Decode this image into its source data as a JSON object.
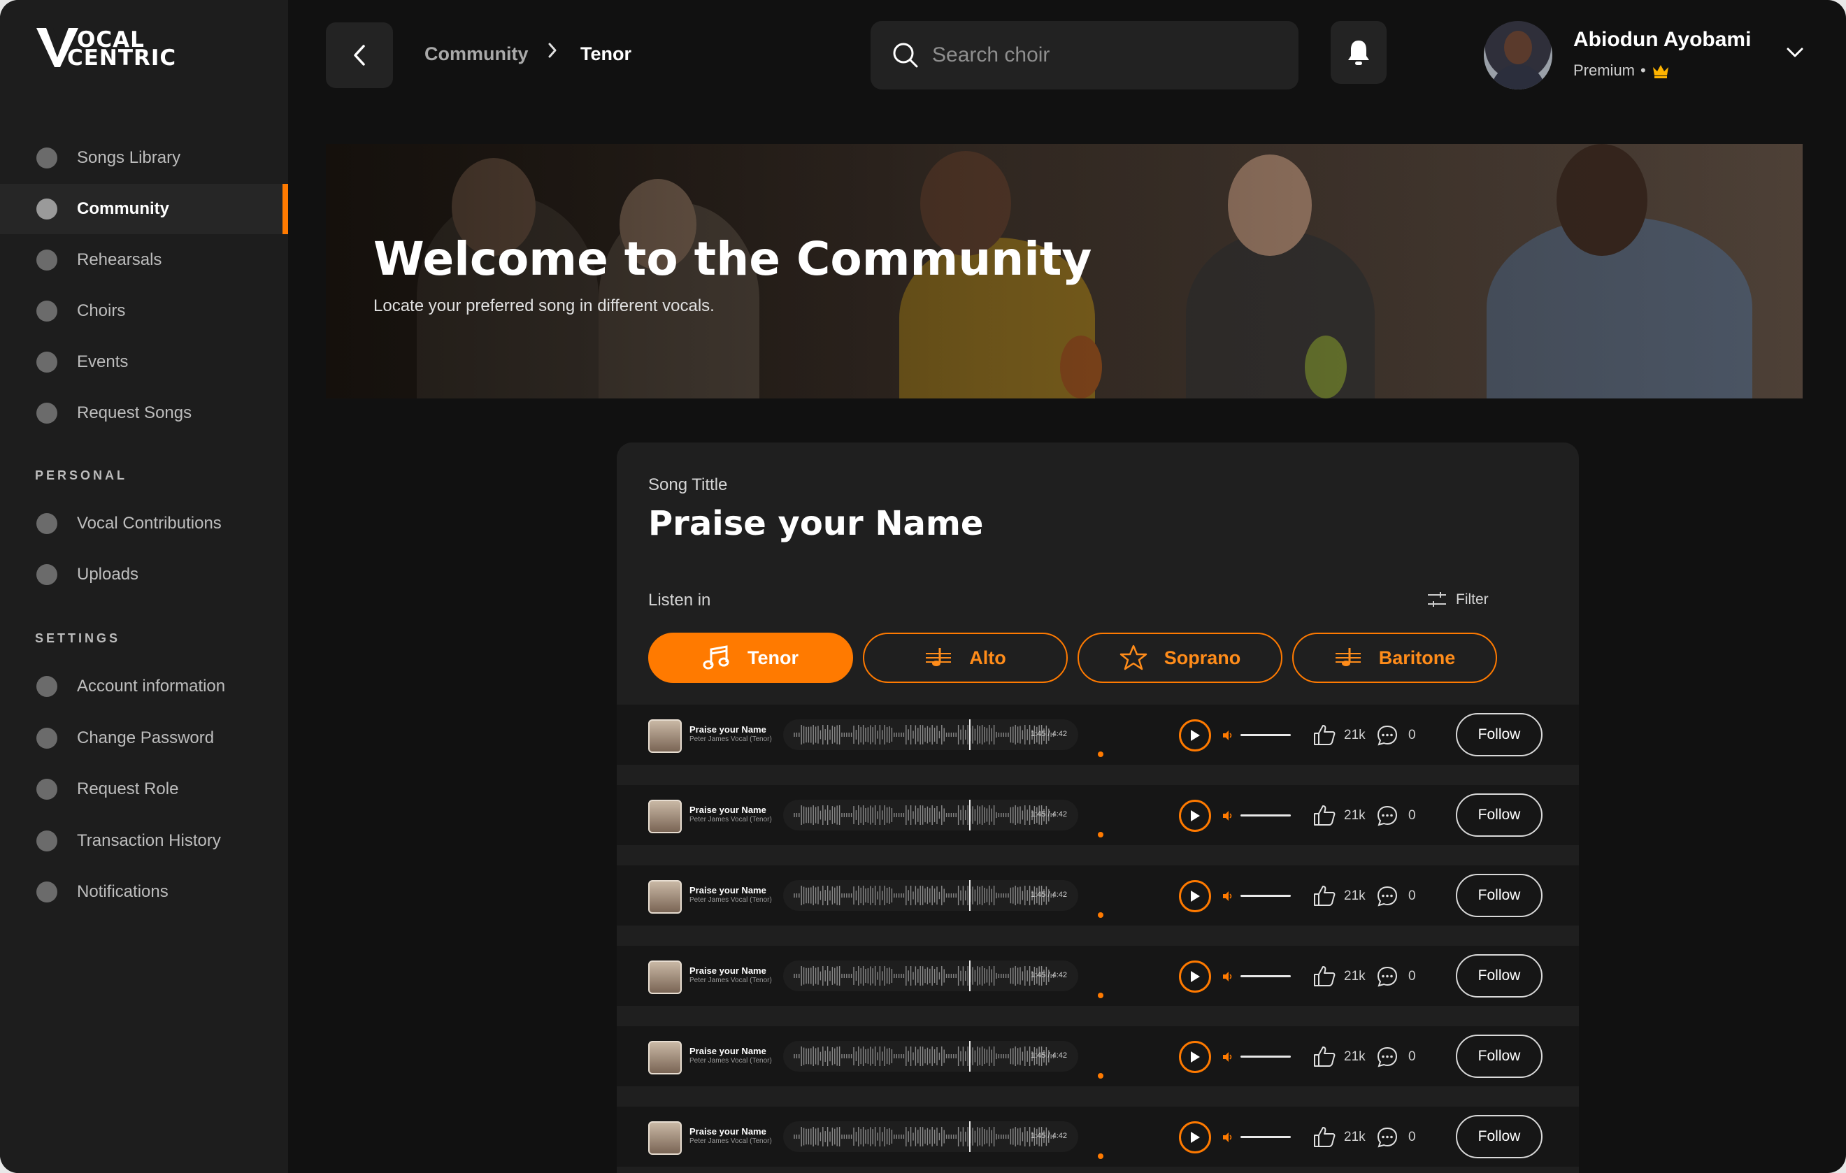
{
  "app": {
    "logo_top": "OCAL",
    "logo_bottom": "CENTRIC"
  },
  "sidebar": {
    "main_items": [
      {
        "label": "Songs Library",
        "icon": "library-icon"
      },
      {
        "label": "Community",
        "icon": "community-icon",
        "active": true
      },
      {
        "label": "Rehearsals",
        "icon": "rehearsal-icon"
      },
      {
        "label": "Choirs",
        "icon": "choir-icon"
      },
      {
        "label": "Events",
        "icon": "events-icon"
      },
      {
        "label": "Request Songs",
        "icon": "request-icon"
      }
    ],
    "personal_label": "PERSONAL",
    "personal_items": [
      {
        "label": "Vocal Contributions",
        "icon": "vocal-icon"
      },
      {
        "label": "Uploads",
        "icon": "upload-icon"
      }
    ],
    "settings_label": "SETTINGS",
    "settings_items": [
      {
        "label": "Account information",
        "icon": "account-icon"
      },
      {
        "label": "Change Password",
        "icon": "password-icon"
      },
      {
        "label": "Request Role",
        "icon": "role-icon"
      },
      {
        "label": "Transaction History",
        "icon": "history-icon"
      },
      {
        "label": "Notifications",
        "icon": "notification-icon"
      }
    ]
  },
  "header": {
    "breadcrumb": [
      "Community",
      "Tenor"
    ],
    "search_placeholder": "Search choir",
    "user_name": "Abiodun Ayobami",
    "user_role": "Premium",
    "accent": "#ff7a00"
  },
  "banner": {
    "title": "Welcome to the Community",
    "subtitle": "Locate your preferred song in different vocals."
  },
  "song": {
    "label": "Song Tittle",
    "title": "Praise your Name",
    "listen_label": "Listen in",
    "filter_label": "Filter",
    "vocals": [
      {
        "label": "Tenor",
        "active": true,
        "icon": "music-note-icon"
      },
      {
        "label": "Alto",
        "active": false,
        "icon": "staff-icon"
      },
      {
        "label": "Soprano",
        "active": false,
        "icon": "star-icon"
      },
      {
        "label": "Baritone",
        "active": false,
        "icon": "staff-icon"
      }
    ]
  },
  "tracks": [
    {
      "name": "Praise your Name",
      "artist": "Peter James Vocal (Tenor)",
      "time": "1:45 / 4:42",
      "progress": 0.37,
      "likes": "21k",
      "comments": "0",
      "follow": "Follow"
    },
    {
      "name": "Praise your Name",
      "artist": "Peter James Vocal (Tenor)",
      "time": "1:45 / 4:42",
      "progress": 0.37,
      "likes": "21k",
      "comments": "0",
      "follow": "Follow"
    },
    {
      "name": "Praise your Name",
      "artist": "Peter James Vocal (Tenor)",
      "time": "1:45 / 4:42",
      "progress": 0.37,
      "likes": "21k",
      "comments": "0",
      "follow": "Follow"
    },
    {
      "name": "Praise your Name",
      "artist": "Peter James Vocal (Tenor)",
      "time": "1:45 / 4:42",
      "progress": 0.37,
      "likes": "21k",
      "comments": "0",
      "follow": "Follow"
    },
    {
      "name": "Praise your Name",
      "artist": "Peter James Vocal (Tenor)",
      "time": "1:45 / 4:42",
      "progress": 0.37,
      "likes": "21k",
      "comments": "0",
      "follow": "Follow"
    },
    {
      "name": "Praise your Name",
      "artist": "Peter James Vocal (Tenor)",
      "time": "1:45 / 4:42",
      "progress": 0.37,
      "likes": "21k",
      "comments": "0",
      "follow": "Follow"
    }
  ]
}
